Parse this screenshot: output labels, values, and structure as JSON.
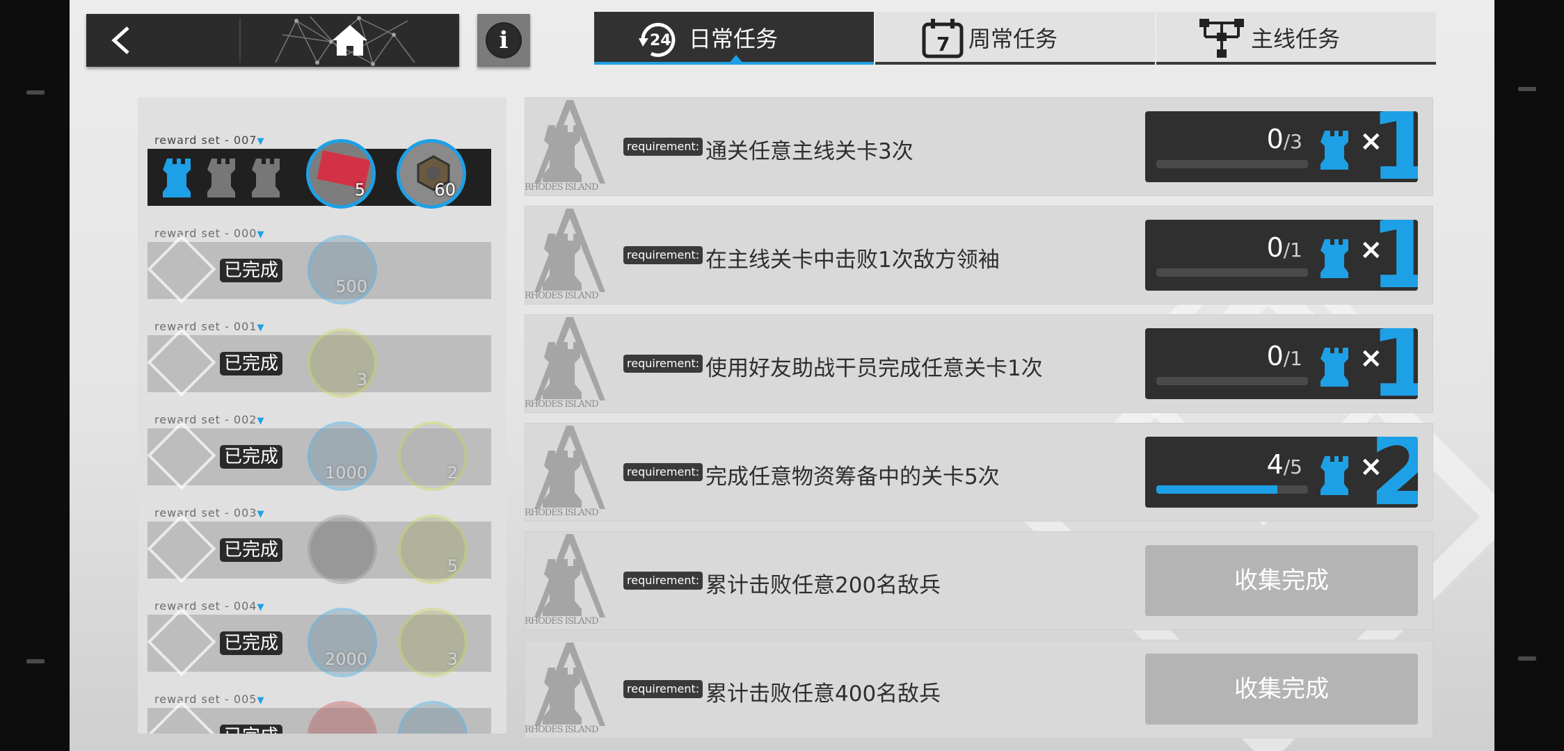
{
  "colors": {
    "accent": "#1ea0e6",
    "dark_panel": "#2b2b2b",
    "completed": "#b4b4b4"
  },
  "icons": {
    "back": "chevron-left-icon",
    "home": "home-icon",
    "info": "info-icon",
    "daily": "24h-refresh-icon",
    "weekly": "calendar-7-icon",
    "main": "hierarchy-icon",
    "reward": "rook-icon"
  },
  "header": {
    "info_glyph": "i"
  },
  "tabs": [
    {
      "label": "日常任务",
      "icon_text": "24",
      "active": true
    },
    {
      "label": "周常任务",
      "icon_text": "7",
      "active": false
    },
    {
      "label": "主线任务",
      "active": false
    }
  ],
  "reward_sets": [
    {
      "label": "reward set - 007",
      "completed": false,
      "earned": 1,
      "slots": 3,
      "items": [
        {
          "count": "5"
        },
        {
          "count": "60"
        }
      ]
    },
    {
      "label": "reward set - 000",
      "completed": true,
      "status": "已完成",
      "items": [
        {
          "count": "500"
        }
      ]
    },
    {
      "label": "reward set - 001",
      "completed": true,
      "status": "已完成",
      "items": [
        {
          "count": "3"
        }
      ]
    },
    {
      "label": "reward set - 002",
      "completed": true,
      "status": "已完成",
      "items": [
        {
          "count": "1000"
        },
        {
          "count": "2"
        }
      ]
    },
    {
      "label": "reward set - 003",
      "completed": true,
      "status": "已完成",
      "items": [
        {
          "count": ""
        },
        {
          "count": "5"
        }
      ]
    },
    {
      "label": "reward set - 004",
      "completed": true,
      "status": "已完成",
      "items": [
        {
          "count": "2000"
        },
        {
          "count": "3"
        }
      ]
    },
    {
      "label": "reward set - 005",
      "completed": true,
      "status": "已完成",
      "items": []
    }
  ],
  "emblem_text": "RHODES ISLAND",
  "quests": [
    {
      "tag": "requirement:",
      "text": "通关任意主线关卡3次",
      "current": "0",
      "total": "/3",
      "progress": 0.0,
      "reward_qty": "1",
      "x": "×",
      "completed": false
    },
    {
      "tag": "requirement:",
      "text": "在主线关卡中击败1次敌方领袖",
      "current": "0",
      "total": "/1",
      "progress": 0.0,
      "reward_qty": "1",
      "x": "×",
      "completed": false
    },
    {
      "tag": "requirement:",
      "text": "使用好友助战干员完成任意关卡1次",
      "current": "0",
      "total": "/1",
      "progress": 0.0,
      "reward_qty": "1",
      "x": "×",
      "completed": false
    },
    {
      "tag": "requirement:",
      "text": "完成任意物资筹备中的关卡5次",
      "current": "4",
      "total": "/5",
      "progress": 0.8,
      "reward_qty": "2",
      "x": "×",
      "completed": false
    },
    {
      "tag": "requirement:",
      "text": "累计击败任意200名敌兵",
      "completed": true,
      "status": "收集完成"
    },
    {
      "tag": "requirement:",
      "text": "累计击败任意400名敌兵",
      "completed": true,
      "status": "收集完成"
    }
  ]
}
